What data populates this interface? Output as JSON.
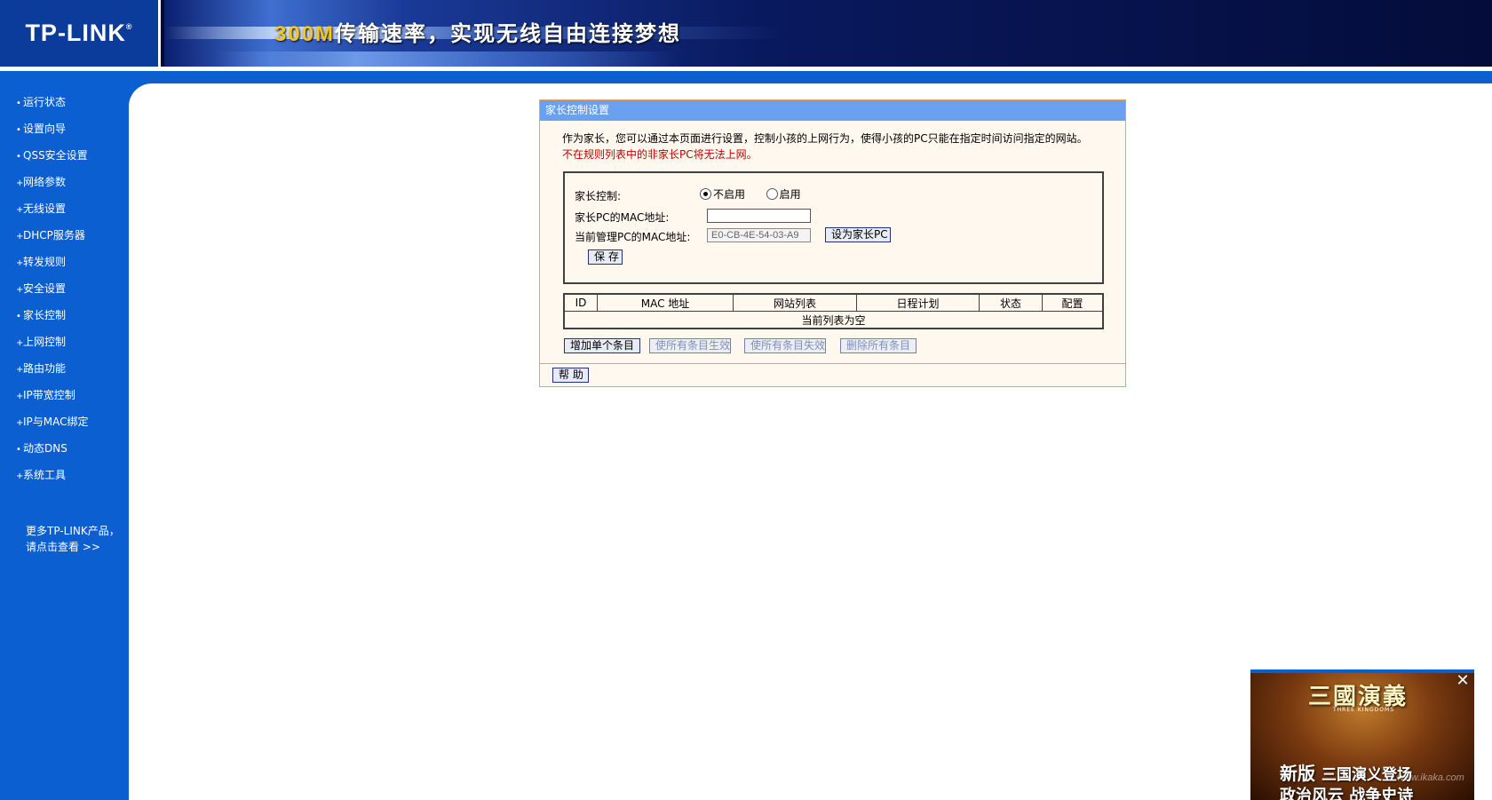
{
  "header": {
    "logo_text": "TP-LINK",
    "logo_mark": "®",
    "slogan_highlight": "300M",
    "slogan_rest": "传输速率，实现无线自由连接梦想"
  },
  "sidebar": {
    "items": [
      {
        "label": "运行状态"
      },
      {
        "label": "设置向导"
      },
      {
        "label": "QSS安全设置"
      },
      {
        "label": "网络参数"
      },
      {
        "label": "无线设置"
      },
      {
        "label": "DHCP服务器"
      },
      {
        "label": "转发规则"
      },
      {
        "label": "安全设置"
      },
      {
        "label": "家长控制"
      },
      {
        "label": "上网控制"
      },
      {
        "label": "路由功能"
      },
      {
        "label": "IP带宽控制"
      },
      {
        "label": "IP与MAC绑定"
      },
      {
        "label": "动态DNS"
      },
      {
        "label": "系统工具"
      }
    ],
    "more_line1": "更多TP-LINK产品，",
    "more_line2": "请点击查看 >>"
  },
  "panel": {
    "title": "家长控制设置",
    "desc_line1": "作为家长，您可以通过本页面进行设置，控制小孩的上网行为，使得小孩的PC只能在指定时间访问指定的网站。",
    "desc_line2": "不在规则列表中的非家长PC将无法上网。",
    "parent_control_label": "家长控制:",
    "option_disable": "不启用",
    "option_enable": "启用",
    "parent_mac_label": "家长PC的MAC地址:",
    "parent_mac_value": "",
    "current_mac_label": "当前管理PC的MAC地址:",
    "current_mac_value": "E0-CB-4E-54-03-A9",
    "set_parent_button": "设为家长PC",
    "save_button": "保 存",
    "table": {
      "headers": [
        "ID",
        "MAC 地址",
        "网站列表",
        "日程计划",
        "状态",
        "配置"
      ],
      "empty_text": "当前列表为空"
    },
    "add_button": "增加单个条目",
    "enable_all_button": "使所有条目生效",
    "disable_all_button": "使所有条目失效",
    "delete_all_button": "删除所有条目",
    "help_button": "帮 助"
  },
  "ad": {
    "title": "三國演義",
    "subtitle": "THREE KINGDOMS",
    "line1_a": "新版",
    "line1_b": "三国演义登场",
    "line2": "政治风云 战争史诗",
    "watermark": "www.ikaka.com"
  }
}
